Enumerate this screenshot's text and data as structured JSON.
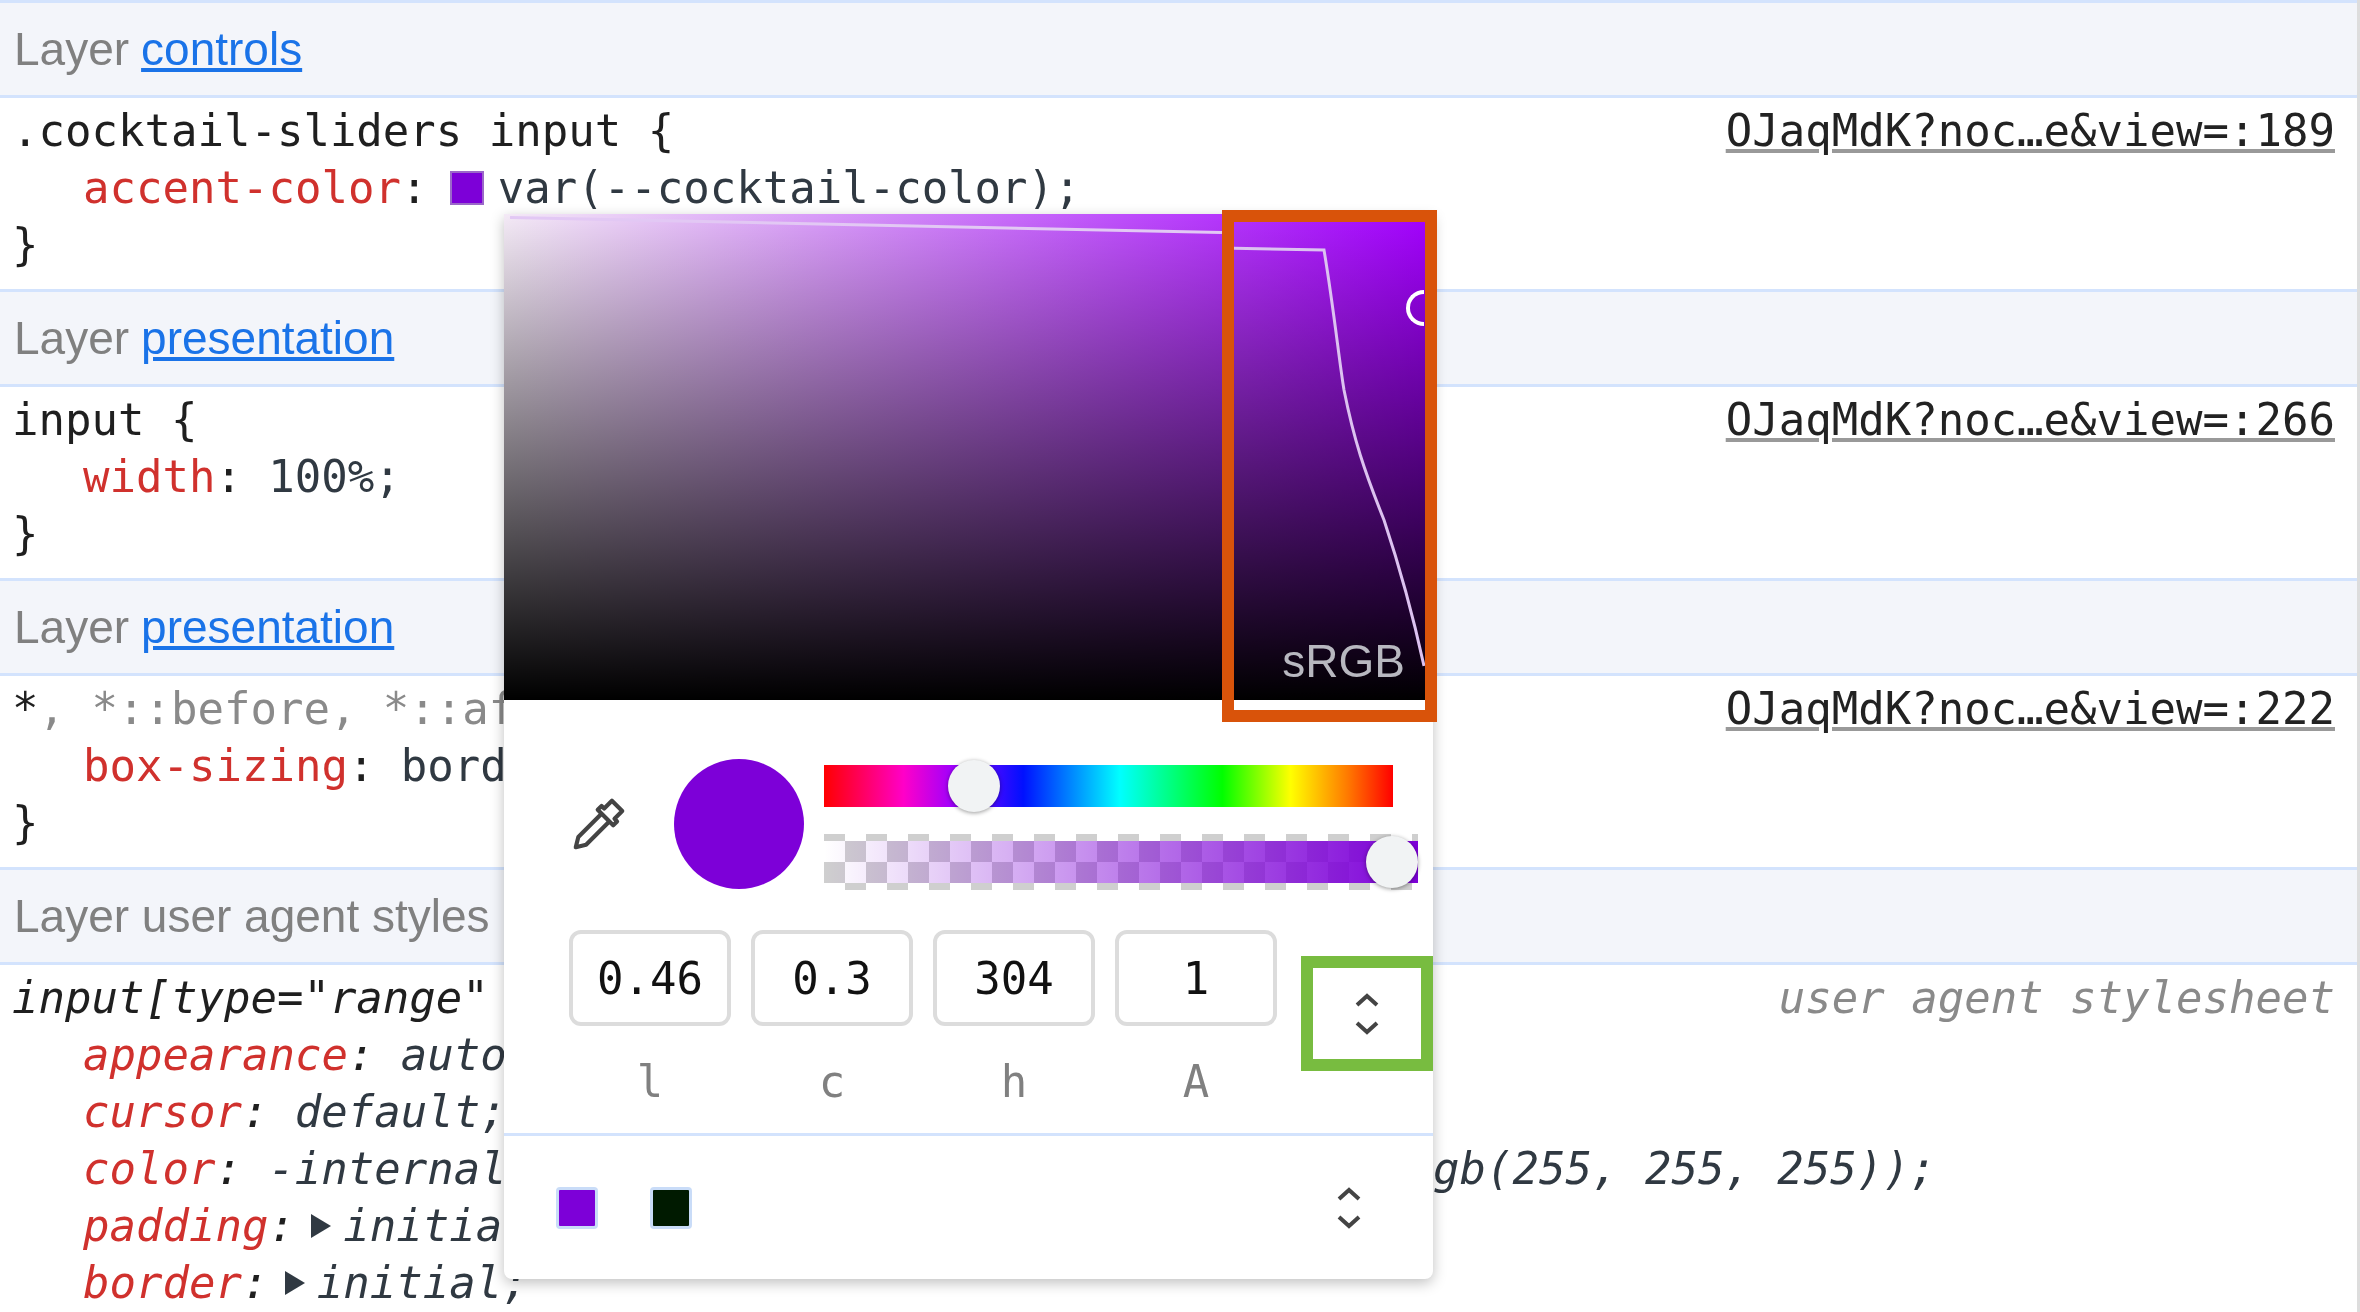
{
  "sections": [
    {
      "header": {
        "text": "Layer",
        "link": "controls"
      },
      "rule": {
        "selectors": [
          {
            "text": ".cocktail-sliders input {",
            "matched": true
          }
        ],
        "source": "OJaqMdK?noc…e&view=:189",
        "declarations": [
          {
            "property": "accent-color",
            "colon": ":",
            "color": "#7d00d8",
            "value": "var(--cocktail-color);"
          }
        ],
        "close": "}",
        "user_agent": false
      }
    },
    {
      "header": {
        "text": "Layer",
        "link": "presentation"
      },
      "rule": {
        "selectors": [
          {
            "text": "input {",
            "matched": true
          }
        ],
        "source": "OJaqMdK?noc…e&view=:266",
        "declarations": [
          {
            "property": "width",
            "colon": ":",
            "value": "100%;"
          }
        ],
        "close": "}",
        "user_agent": false
      }
    },
    {
      "header": {
        "text": "Layer",
        "link": "presentation"
      },
      "rule": {
        "selectors": [
          {
            "text": "*",
            "matched": true
          },
          {
            "text": ", *::before, *::af",
            "matched": false
          }
        ],
        "source": "OJaqMdK?noc…e&view=:222",
        "declarations": [
          {
            "property": "box-sizing",
            "colon": ":",
            "value": "bord"
          }
        ],
        "close": "}",
        "user_agent": false
      }
    },
    {
      "header": {
        "text": "Layer user agent styles"
      },
      "rule": {
        "selectors": [
          {
            "text": "input[type=\"range\"",
            "matched": true
          }
        ],
        "source": "user agent stylesheet",
        "declarations": [
          {
            "property": "appearance",
            "colon": ":",
            "value": "auto"
          },
          {
            "property": "cursor",
            "colon": ":",
            "value": "default;"
          },
          {
            "property": "color",
            "colon": ":",
            "value": "-internal",
            "tail": "gb(255, 255, 255));"
          },
          {
            "property": "padding",
            "colon": ":",
            "expanded": false,
            "value": "initia"
          },
          {
            "property": "border",
            "colon": ":",
            "expanded": false,
            "value": "initial;"
          }
        ],
        "user_agent": true
      }
    }
  ],
  "color_picker": {
    "gamut_label": "sRGB",
    "color": "#7d00d8",
    "hue": {
      "level": 0.24
    },
    "alpha": {
      "level": 1
    },
    "fields": [
      {
        "value": "0.46",
        "label": "l"
      },
      {
        "value": "0.3",
        "label": "c"
      },
      {
        "value": "304",
        "label": "h"
      },
      {
        "value": "1",
        "label": "A"
      }
    ],
    "palette": [
      {
        "color": "#7d00d8"
      },
      {
        "color": "#001a00"
      }
    ]
  }
}
